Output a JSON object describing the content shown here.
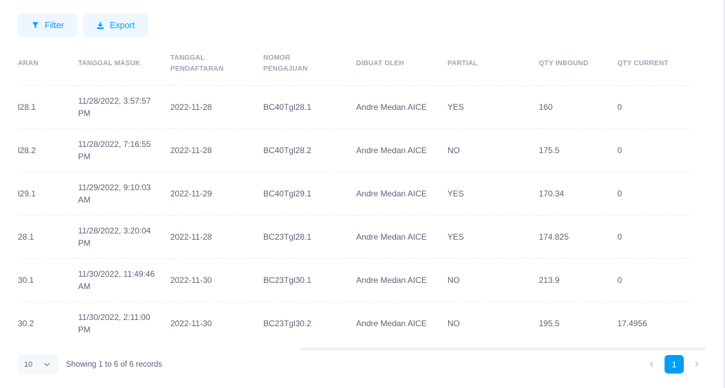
{
  "toolbar": {
    "filter_label": "Filter",
    "export_label": "Export",
    "filter_icon": "filter-icon",
    "export_icon": "download-icon"
  },
  "table": {
    "columns": [
      "ARAN",
      "TANGGAL MASUK",
      "TANGGAL PENDAFTARAN",
      "NOMOR PENGAJUAN",
      "DIBUAT OLEH",
      "PARTIAL",
      "QTY INBOUND",
      "QTY CURRENT"
    ],
    "rows": [
      [
        "l28.1",
        "11/28/2022, 3:57:57 PM",
        "2022-11-28",
        "BC40Tgl28.1",
        "Andre Medan AICE",
        "YES",
        "160",
        "0"
      ],
      [
        "l28.2",
        "11/28/2022, 7:16:55 PM",
        "2022-11-28",
        "BC40Tgl28.2",
        "Andre Medan AICE",
        "NO",
        "175.5",
        "0"
      ],
      [
        "l29.1",
        "11/29/2022, 9:10:03 AM",
        "2022-11-29",
        "BC40Tgl29.1",
        "Andre Medan AICE",
        "YES",
        "170.34",
        "0"
      ],
      [
        "28.1",
        "11/28/2022, 3:20:04 PM",
        "2022-11-28",
        "BC23Tgl28.1",
        "Andre Medan AICE",
        "YES",
        "174.825",
        "0"
      ],
      [
        "30.1",
        "11/30/2022, 11:49:46 AM",
        "2022-11-30",
        "BC23Tgl30.1",
        "Andre Medan AICE",
        "NO",
        "213.9",
        "0"
      ],
      [
        "30.2",
        "11/30/2022, 2:11:00 PM",
        "2022-11-30",
        "BC23Tgl30.2",
        "Andre Medan AICE",
        "NO",
        "195.5",
        "17.4956"
      ]
    ]
  },
  "footer": {
    "page_size": "10",
    "records_text": "Showing 1 to 6 of 6 records",
    "current_page": "1"
  },
  "colors": {
    "accent": "#009ef7",
    "accent_light": "#eef6ff",
    "text": "#5e6278",
    "header_text": "#a1a5b7"
  }
}
